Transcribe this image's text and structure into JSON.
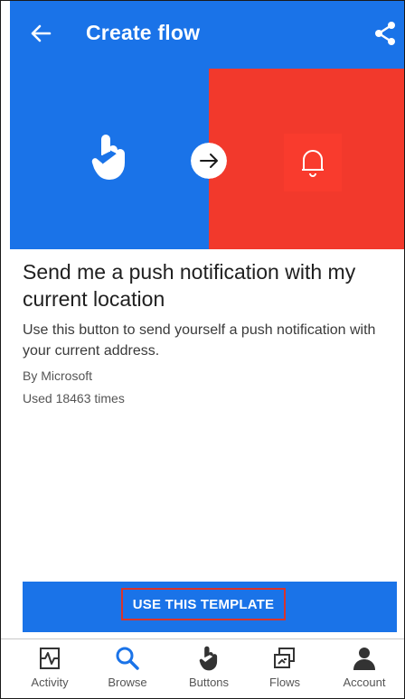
{
  "app_bar": {
    "title": "Create flow"
  },
  "template": {
    "heading": "Send me a push notification with my current location",
    "description": "Use this button to send yourself a push notification with your current address.",
    "author": "By Microsoft",
    "usage": "Used 18463 times"
  },
  "cta": {
    "label": "USE THIS TEMPLATE"
  },
  "bottom_nav": {
    "items": [
      {
        "label": "Activity",
        "icon": "activity-icon"
      },
      {
        "label": "Browse",
        "icon": "search-icon",
        "active": true
      },
      {
        "label": "Buttons",
        "icon": "touch-icon"
      },
      {
        "label": "Flows",
        "icon": "flows-icon"
      },
      {
        "label": "Account",
        "icon": "account-icon"
      }
    ]
  },
  "colors": {
    "primary": "#1a73e8",
    "accent_red": "#f2392c",
    "highlight_border": "#d9342b"
  }
}
